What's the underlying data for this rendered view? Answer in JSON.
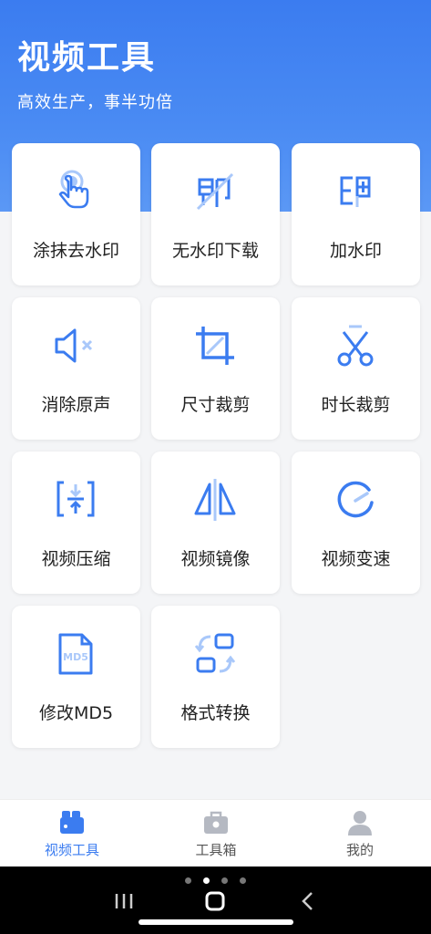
{
  "header": {
    "title": "视频工具",
    "subtitle": "高效生产，事半功倍"
  },
  "tools": [
    {
      "label": "涂抹去水印",
      "icon": "tap-hand-icon"
    },
    {
      "label": "无水印下载",
      "icon": "no-watermark-icon"
    },
    {
      "label": "加水印",
      "icon": "add-watermark-icon"
    },
    {
      "label": "消除原声",
      "icon": "mute-speaker-icon"
    },
    {
      "label": "尺寸裁剪",
      "icon": "crop-icon"
    },
    {
      "label": "时长裁剪",
      "icon": "scissors-icon"
    },
    {
      "label": "视频压缩",
      "icon": "compress-icon"
    },
    {
      "label": "视频镜像",
      "icon": "mirror-icon"
    },
    {
      "label": "视频变速",
      "icon": "speed-gauge-icon"
    },
    {
      "label": "修改MD5",
      "icon": "md5-file-icon"
    },
    {
      "label": "格式转换",
      "icon": "convert-format-icon"
    }
  ],
  "tabbar": {
    "tabs": [
      {
        "label": "视频工具",
        "icon": "video-camera-icon",
        "active": true
      },
      {
        "label": "工具箱",
        "icon": "toolbox-icon",
        "active": false
      },
      {
        "label": "我的",
        "icon": "user-icon",
        "active": false
      }
    ]
  },
  "colors": {
    "accent": "#3b7cf0",
    "icon": "#4a8bf3",
    "tab_inactive": "#b5b9c2"
  }
}
